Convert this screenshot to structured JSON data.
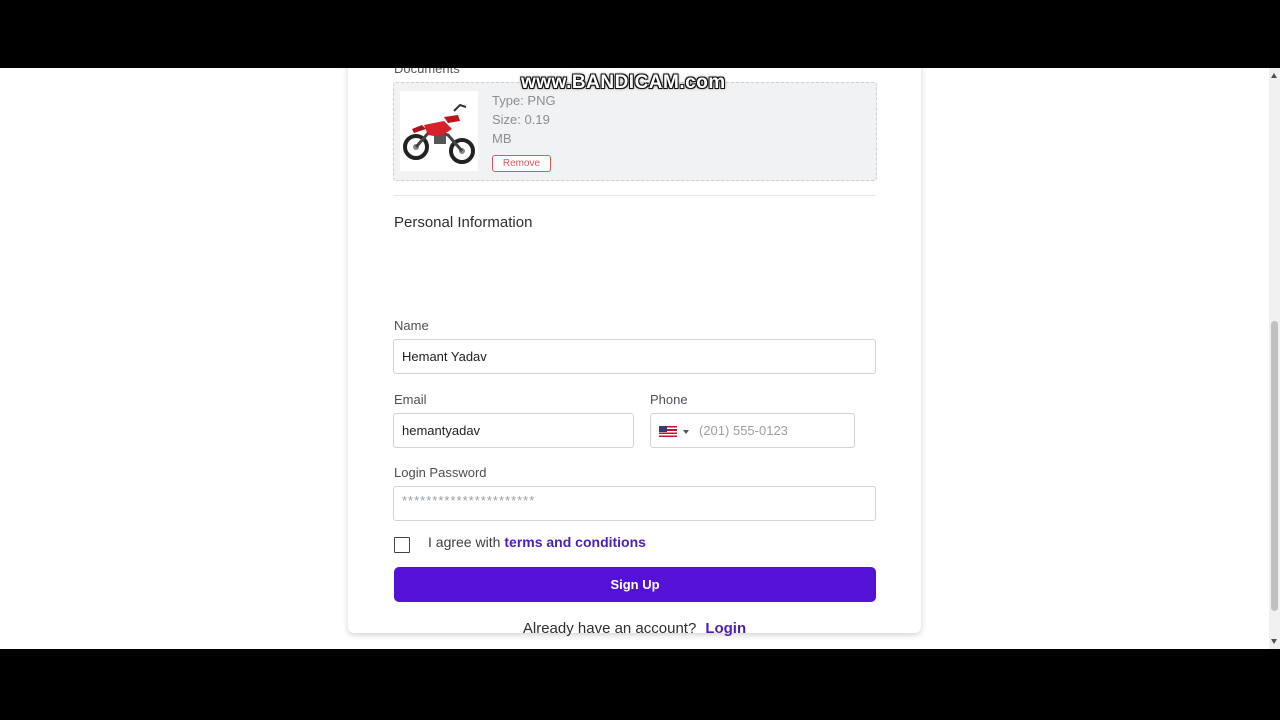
{
  "documents": {
    "label": "Documents",
    "file": {
      "type_text": "Type: PNG",
      "size_text": "Size: 0.19 MB",
      "remove_label": "Remove"
    }
  },
  "personal_info": {
    "title": "Personal Information",
    "name": {
      "label": "Name",
      "value": "Hemant Yadav"
    },
    "email": {
      "label": "Email",
      "value": "hemantyadav"
    },
    "phone": {
      "label": "Phone",
      "placeholder": "(201) 555-0123",
      "country": "US"
    },
    "password": {
      "label": "Login Password",
      "value": "**********************"
    }
  },
  "agree": {
    "text": "I agree with",
    "link": "terms and conditions",
    "checked": false
  },
  "signup_label": "Sign Up",
  "login_prompt": {
    "text": "Already have an account?",
    "link": "Login"
  },
  "watermark": "www.BANDICAM.com",
  "colors": {
    "primary": "#5412d6",
    "link": "#4b1fb8",
    "danger": "#e0555b"
  }
}
